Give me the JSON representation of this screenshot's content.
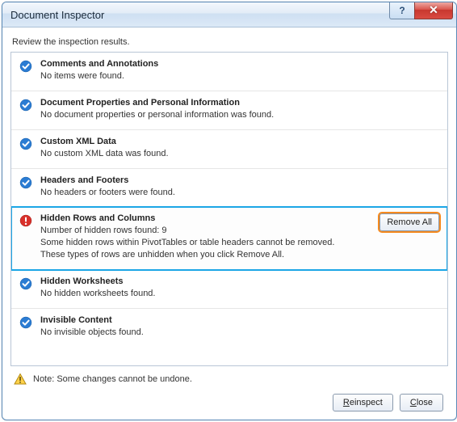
{
  "window": {
    "title": "Document Inspector",
    "help_label": "?",
    "close_label": "✕"
  },
  "instruction": "Review the inspection results.",
  "items": [
    {
      "icon": "check",
      "title": "Comments and Annotations",
      "desc": "No items were found."
    },
    {
      "icon": "check",
      "title": "Document Properties and Personal Information",
      "desc": "No document properties or personal information was found."
    },
    {
      "icon": "check",
      "title": "Custom XML Data",
      "desc": "No custom XML data was found."
    },
    {
      "icon": "check",
      "title": "Headers and Footers",
      "desc": "No headers or footers were found."
    },
    {
      "icon": "alert",
      "title": "Hidden Rows and Columns",
      "desc": "Number of hidden rows found: 9\nSome hidden rows within PivotTables or table headers cannot be removed.\nThese types of rows are unhidden when you click Remove All.",
      "action": "Remove All",
      "highlight": true
    },
    {
      "icon": "check",
      "title": "Hidden Worksheets",
      "desc": "No hidden worksheets found."
    },
    {
      "icon": "check",
      "title": "Invisible Content",
      "desc": "No invisible objects found."
    }
  ],
  "note": "Note: Some changes cannot be undone.",
  "buttons": {
    "reinspect": "Reinspect",
    "close": "Close"
  }
}
